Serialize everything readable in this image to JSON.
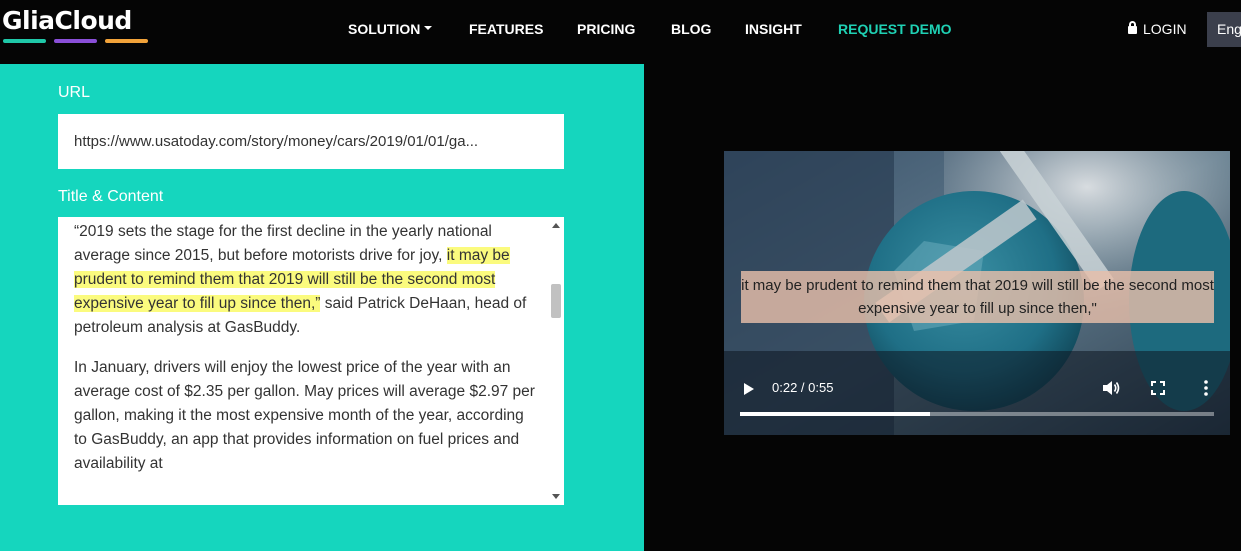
{
  "brand": {
    "name": "GliaCloud",
    "bar_colors": [
      "#1fc8a8",
      "#8a4fd8",
      "#f2a33a"
    ]
  },
  "nav": {
    "items": [
      {
        "label": "SOLUTION",
        "dropdown": true
      },
      {
        "label": "FEATURES"
      },
      {
        "label": "PRICING"
      },
      {
        "label": "BLOG"
      },
      {
        "label": "INSIGHT"
      },
      {
        "label": "REQUEST DEMO",
        "accent": "#1fd1b4"
      }
    ],
    "login_label": "LOGIN",
    "language_label": "Eng"
  },
  "form": {
    "url_label": "URL",
    "url_value": "https://www.usatoday.com/story/money/cars/2019/01/01/ga...",
    "content_label": "Title & Content",
    "paragraph1_before": "“2019 sets the stage for the first decline in the yearly national average since 2015, but before motorists drive for joy, ",
    "paragraph1_highlight": "it may be prudent to remind them that 2019 will still be the second most expensive year to fill up since then,”",
    "paragraph1_after": " said Patrick DeHaan, head of petroleum analysis at GasBuddy.",
    "paragraph2": "In January, drivers will enjoy the lowest price of the year with an average cost of $2.35 per gallon. May prices will average $2.97 per gallon, making it the most expensive month of the year, according to GasBuddy, an app that provides information on fuel prices and availability at",
    "highlight_color": "#fbfb7e"
  },
  "video": {
    "caption": "it may be prudent to remind them that 2019 will still be the second most expensive year to fill up since then,\"",
    "time_display": "0:22 / 0:55",
    "progress_fraction": 0.4
  }
}
